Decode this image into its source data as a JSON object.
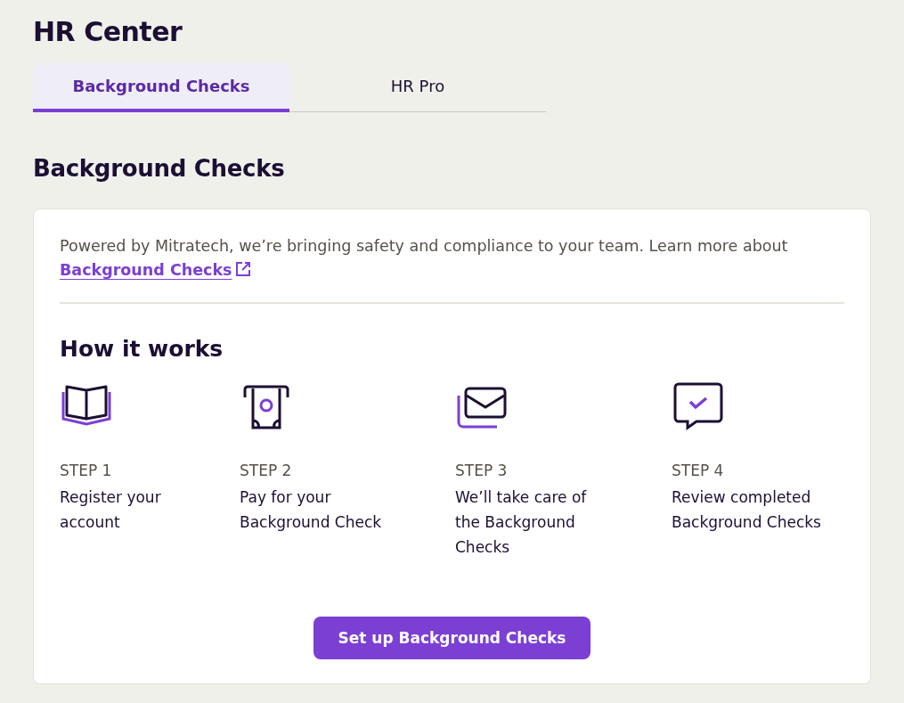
{
  "page_title": "HR Center",
  "tabs": [
    {
      "label": "Background Checks",
      "selected": true
    },
    {
      "label": "HR Pro",
      "selected": false
    }
  ],
  "section_title": "Background Checks",
  "intro": {
    "text": "Powered by Mitratech, we’re bringing safety and compliance to your team. Learn more about",
    "link": "Background Checks"
  },
  "how_title": "How it works",
  "steps": [
    {
      "kind": "book",
      "step": "STEP 1",
      "text": "Register your account"
    },
    {
      "kind": "payment",
      "step": "STEP 2",
      "text": "Pay for your Background Check"
    },
    {
      "kind": "mail",
      "step": "STEP 3",
      "text": "We’ll take care of the Background Checks"
    },
    {
      "kind": "review",
      "step": "STEP 4",
      "text": "Review completed Background Checks"
    }
  ],
  "button": "Set up Background Checks"
}
